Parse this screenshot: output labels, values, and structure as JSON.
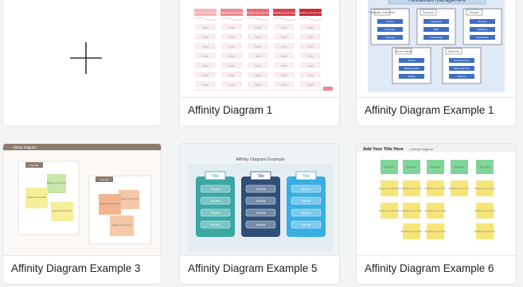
{
  "new_card": {
    "icon": "plus-icon"
  },
  "cards": [
    {
      "label": "Affinity Diagram 1",
      "thumb": {
        "headers": [
          "Replace your text here",
          "Replace your text here",
          "Replace your text here",
          "Replace your text here",
          "Replace your text here"
        ],
        "row_text": "Details",
        "header_colors": [
          "#f6b3b9",
          "#f08a93",
          "#e96b76",
          "#d94250",
          "#c92e3b"
        ]
      }
    },
    {
      "label": "Affinity Diagram Example 1",
      "thumb": {
        "title": "Restaurant management",
        "groups": [
          {
            "title": "The quality of personnel",
            "items": [
              "Service",
              "Profession",
              "Diversity"
            ]
          },
          {
            "title": "Food taste",
            "items": [
              "Ingredients",
              "Taste",
              "Food design"
            ]
          },
          {
            "title": "Promote",
            "items": [
              "Promote",
              "Marketing",
              "Brand value"
            ]
          },
          {
            "title": "Service attitude",
            "items": [
              "Service",
              "Building sense",
              "Display"
            ]
          },
          {
            "title": "Order time",
            "items": [
              "Production time",
              "Short order time",
              "Delivery"
            ]
          }
        ]
      }
    },
    {
      "label": "Affinity Diagram Example 3",
      "thumb": {
        "header": "Affinity Diagram",
        "box1": "Text title",
        "box2": "Text title",
        "note_text": "Replace your text here"
      }
    },
    {
      "label": "Affinity Diagram Example 5",
      "thumb": {
        "title": "Affinity Diagram Example",
        "columns": [
          "Title",
          "Title",
          "Title"
        ],
        "item_text": "Text text",
        "colors": [
          "#3aa7a3",
          "#2f4f78",
          "#3aaee3"
        ]
      }
    },
    {
      "label": "Affinity Diagram Example 6",
      "thumb": {
        "header_title": "Add Your Title Here",
        "header_sub": "Affinity Diagram",
        "green_text": "Text here",
        "note_text": "Replace your text here"
      }
    }
  ]
}
